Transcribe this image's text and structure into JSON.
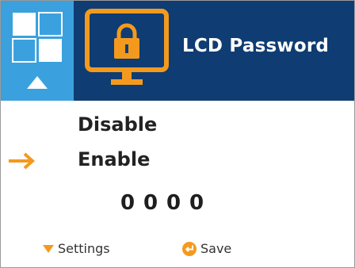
{
  "header": {
    "title": "LCD Password",
    "nav_icon": "grid-icon",
    "up_icon": "up-triangle-icon",
    "screen_icon": "lcd-lock-icon"
  },
  "options": [
    {
      "label": "Disable",
      "selected": false
    },
    {
      "label": "Enable",
      "selected": true
    }
  ],
  "selection_icon": "arrow-right-icon",
  "pin": {
    "digits": [
      "0",
      "0",
      "0",
      "0"
    ]
  },
  "footer": {
    "settings_label": "Settings",
    "settings_icon": "triangle-down-icon",
    "save_label": "Save",
    "save_icon": "enter-icon"
  },
  "colors": {
    "header_bg": "#0f3c72",
    "nav_bg": "#3aa1de",
    "accent": "#f39a1e",
    "text": "#222222"
  }
}
